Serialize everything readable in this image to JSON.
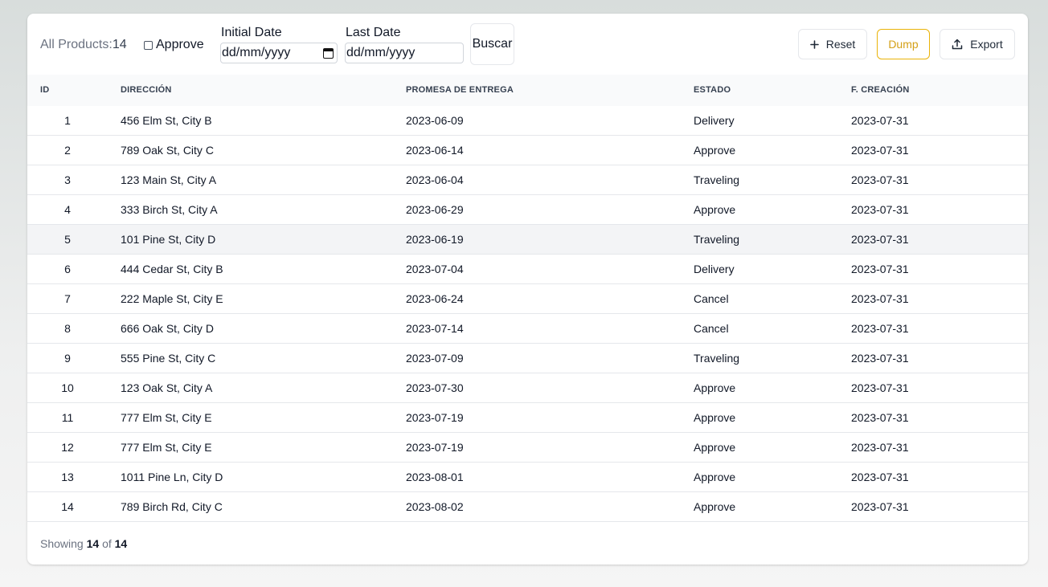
{
  "toolbar": {
    "total_label": "All Products:",
    "total_count": "14",
    "approve_label": "Approve",
    "initial_date_label": "Initial Date",
    "last_date_label": "Last Date",
    "date_placeholder": "dd/mm/yyyy",
    "search_label": "Buscar",
    "reset_label": "Reset",
    "dump_label": "Dump",
    "export_label": "Export",
    "approve_checked": false
  },
  "table": {
    "columns": [
      "ID",
      "DIRECCIÓN",
      "PROMESA DE ENTREGA",
      "ESTADO",
      "F. CREACIÓN"
    ],
    "rows": [
      [
        "1",
        "456 Elm St, City B",
        "2023-06-09",
        "Delivery",
        "2023-07-31"
      ],
      [
        "2",
        "789 Oak St, City C",
        "2023-06-14",
        "Approve",
        "2023-07-31"
      ],
      [
        "3",
        "123 Main St, City A",
        "2023-06-04",
        "Traveling",
        "2023-07-31"
      ],
      [
        "4",
        "333 Birch St, City A",
        "2023-06-29",
        "Approve",
        "2023-07-31"
      ],
      [
        "5",
        "101 Pine St, City D",
        "2023-06-19",
        "Traveling",
        "2023-07-31"
      ],
      [
        "6",
        "444 Cedar St, City B",
        "2023-07-04",
        "Delivery",
        "2023-07-31"
      ],
      [
        "7",
        "222 Maple St, City E",
        "2023-06-24",
        "Cancel",
        "2023-07-31"
      ],
      [
        "8",
        "666 Oak St, City D",
        "2023-07-14",
        "Cancel",
        "2023-07-31"
      ],
      [
        "9",
        "555 Pine St, City C",
        "2023-07-09",
        "Traveling",
        "2023-07-31"
      ],
      [
        "10",
        "123 Oak St, City A",
        "2023-07-30",
        "Approve",
        "2023-07-31"
      ],
      [
        "11",
        "777 Elm St, City E",
        "2023-07-19",
        "Approve",
        "2023-07-31"
      ],
      [
        "12",
        "777 Elm St, City E",
        "2023-07-19",
        "Approve",
        "2023-07-31"
      ],
      [
        "13",
        "1011 Pine Ln, City D",
        "2023-08-01",
        "Approve",
        "2023-07-31"
      ],
      [
        "14",
        "789 Birch Rd, City C",
        "2023-08-02",
        "Approve",
        "2023-07-31"
      ]
    ]
  },
  "footer": {
    "showing_label": "Showing",
    "shown": "14",
    "of_label": "of",
    "total": "14"
  },
  "colors": {
    "dump_accent": "#eab308",
    "header_bg": "#f9fafb",
    "hover_row_bg": "#f3f4f6"
  }
}
